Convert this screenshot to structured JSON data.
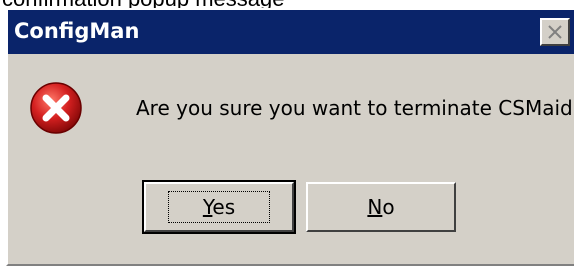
{
  "caption": "confirmation popup message",
  "dialog": {
    "title": "ConfigMan",
    "close_symbol": "✕",
    "icon": "error-x-icon",
    "message": "Are you sure you want to terminate CSMaid?",
    "buttons": {
      "yes_accel": "Y",
      "yes_rest": "es",
      "no_accel": "N",
      "no_rest": "o"
    }
  },
  "colors": {
    "titlebar": "#0a246a",
    "face": "#d4d0c8",
    "error_red": "#d42020"
  }
}
